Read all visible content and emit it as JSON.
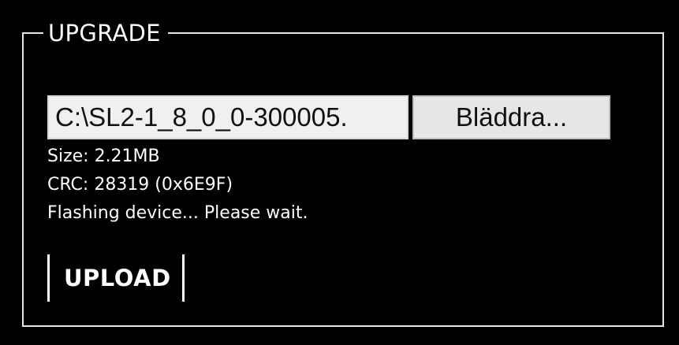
{
  "upgrade": {
    "legend": "UPGRADE",
    "file_input": {
      "value": "C:\\SL2-1_8_0_0-300005."
    },
    "browse_label": "Bläddra...",
    "size_text": "Size: 2.21MB",
    "crc_text": "CRC: 28319 (0x6E9F)",
    "status_text": "Flashing device... Please wait.",
    "upload_label": "UPLOAD"
  },
  "colors": {
    "background": "#000000",
    "border": "#e6e6e6",
    "text": "#ffffff",
    "input_background": "#f0f0f0",
    "button_background": "#e6e6e6"
  }
}
